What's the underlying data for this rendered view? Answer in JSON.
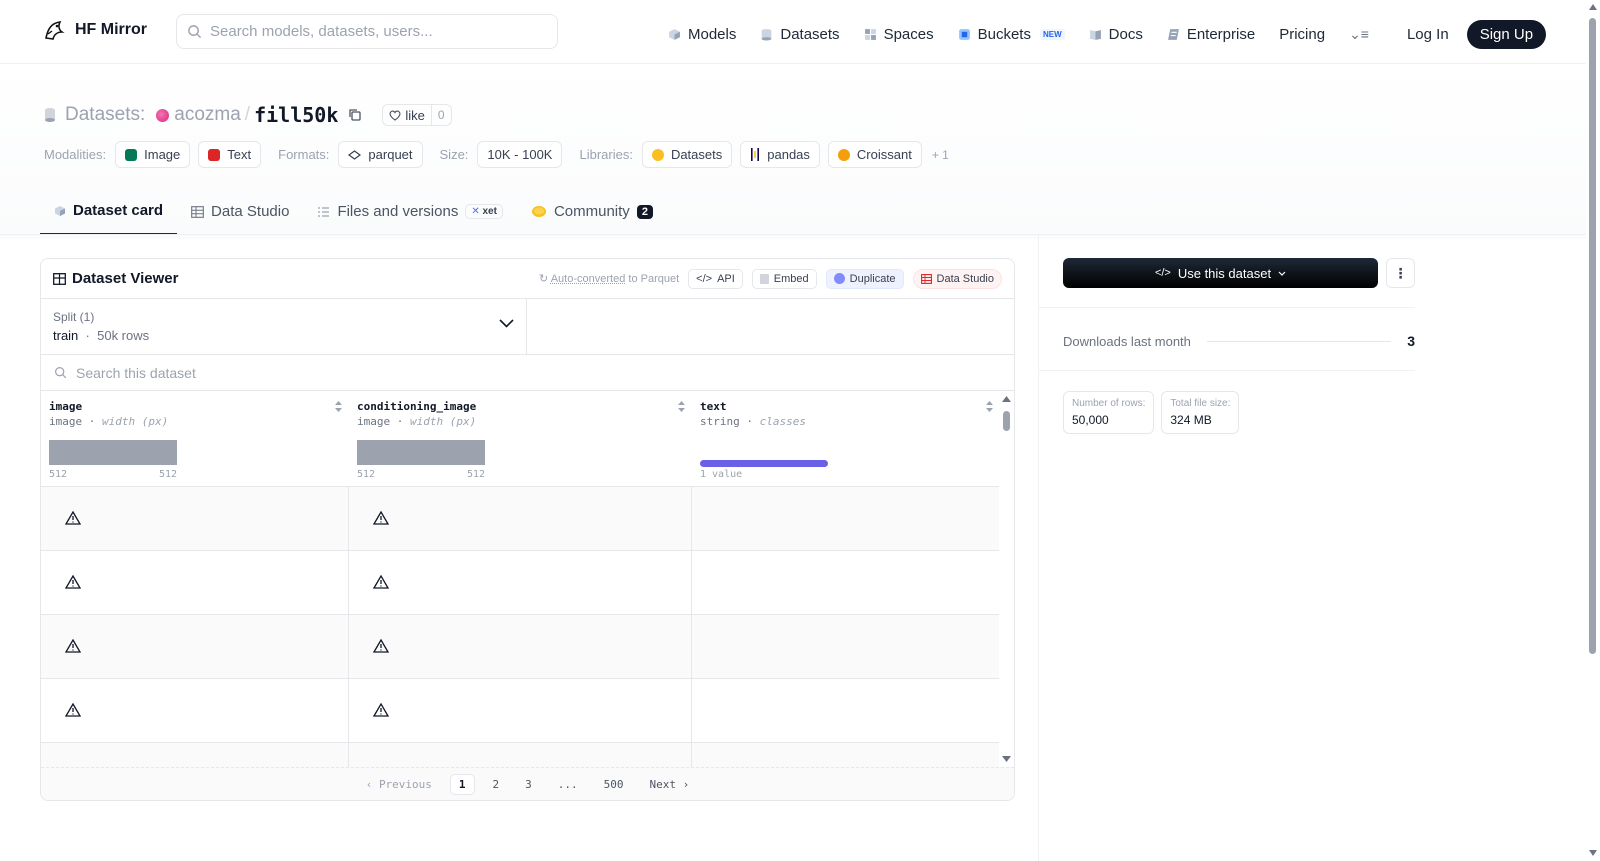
{
  "header": {
    "brand": "HF Mirror",
    "search_placeholder": "Search models, datasets, users...",
    "nav": [
      {
        "label": "Models",
        "icon": "models-icon"
      },
      {
        "label": "Datasets",
        "icon": "datasets-icon"
      },
      {
        "label": "Spaces",
        "icon": "spaces-icon"
      },
      {
        "label": "Buckets",
        "icon": "buckets-icon",
        "badge": "NEW"
      },
      {
        "label": "Docs",
        "icon": "docs-icon"
      },
      {
        "label": "Enterprise",
        "icon": "enterprise-icon"
      },
      {
        "label": "Pricing"
      }
    ],
    "login": "Log In",
    "signup": "Sign Up"
  },
  "dataset": {
    "section_label": "Datasets:",
    "owner": "acozma",
    "name": "fill50k",
    "like_label": "like",
    "like_count": "0",
    "modalities_label": "Modalities:",
    "modalities": [
      "Image",
      "Text"
    ],
    "formats_label": "Formats:",
    "format": "parquet",
    "size_label": "Size:",
    "size": "10K - 100K",
    "libraries_label": "Libraries:",
    "libraries": [
      "Datasets",
      "pandas",
      "Croissant"
    ],
    "libraries_more": "+ 1"
  },
  "tabs": [
    {
      "label": "Dataset card",
      "active": true
    },
    {
      "label": "Data Studio"
    },
    {
      "label": "Files and versions",
      "badge": "xet"
    },
    {
      "label": "Community",
      "count": "2"
    }
  ],
  "viewer": {
    "title": "Dataset Viewer",
    "auto_converted": "Auto-converted",
    "auto_suffix": " to Parquet",
    "api": "API",
    "embed": "Embed",
    "duplicate": "Duplicate",
    "data_studio": "Data Studio",
    "split_label": "Split (1)",
    "split_name": "train",
    "split_rows": "50k rows",
    "search_placeholder": "Search this dataset",
    "columns": [
      {
        "name": "image",
        "type": "image",
        "stat": "width (px)",
        "min": "512",
        "max": "512"
      },
      {
        "name": "conditioning_image",
        "type": "image",
        "stat": "width (px)",
        "min": "512",
        "max": "512"
      },
      {
        "name": "text",
        "type": "string",
        "stat": "classes",
        "summary": "1 value"
      }
    ],
    "pagination": {
      "prev": "Previous",
      "pages": [
        "1",
        "2",
        "3",
        "...",
        "500"
      ],
      "next": "Next"
    }
  },
  "sidebar": {
    "use_button": "Use this dataset",
    "downloads_label": "Downloads last month",
    "downloads_value": "3",
    "rows_label": "Number of rows:",
    "rows_value": "50,000",
    "size_label": "Total file size:",
    "size_value": "324 MB"
  }
}
